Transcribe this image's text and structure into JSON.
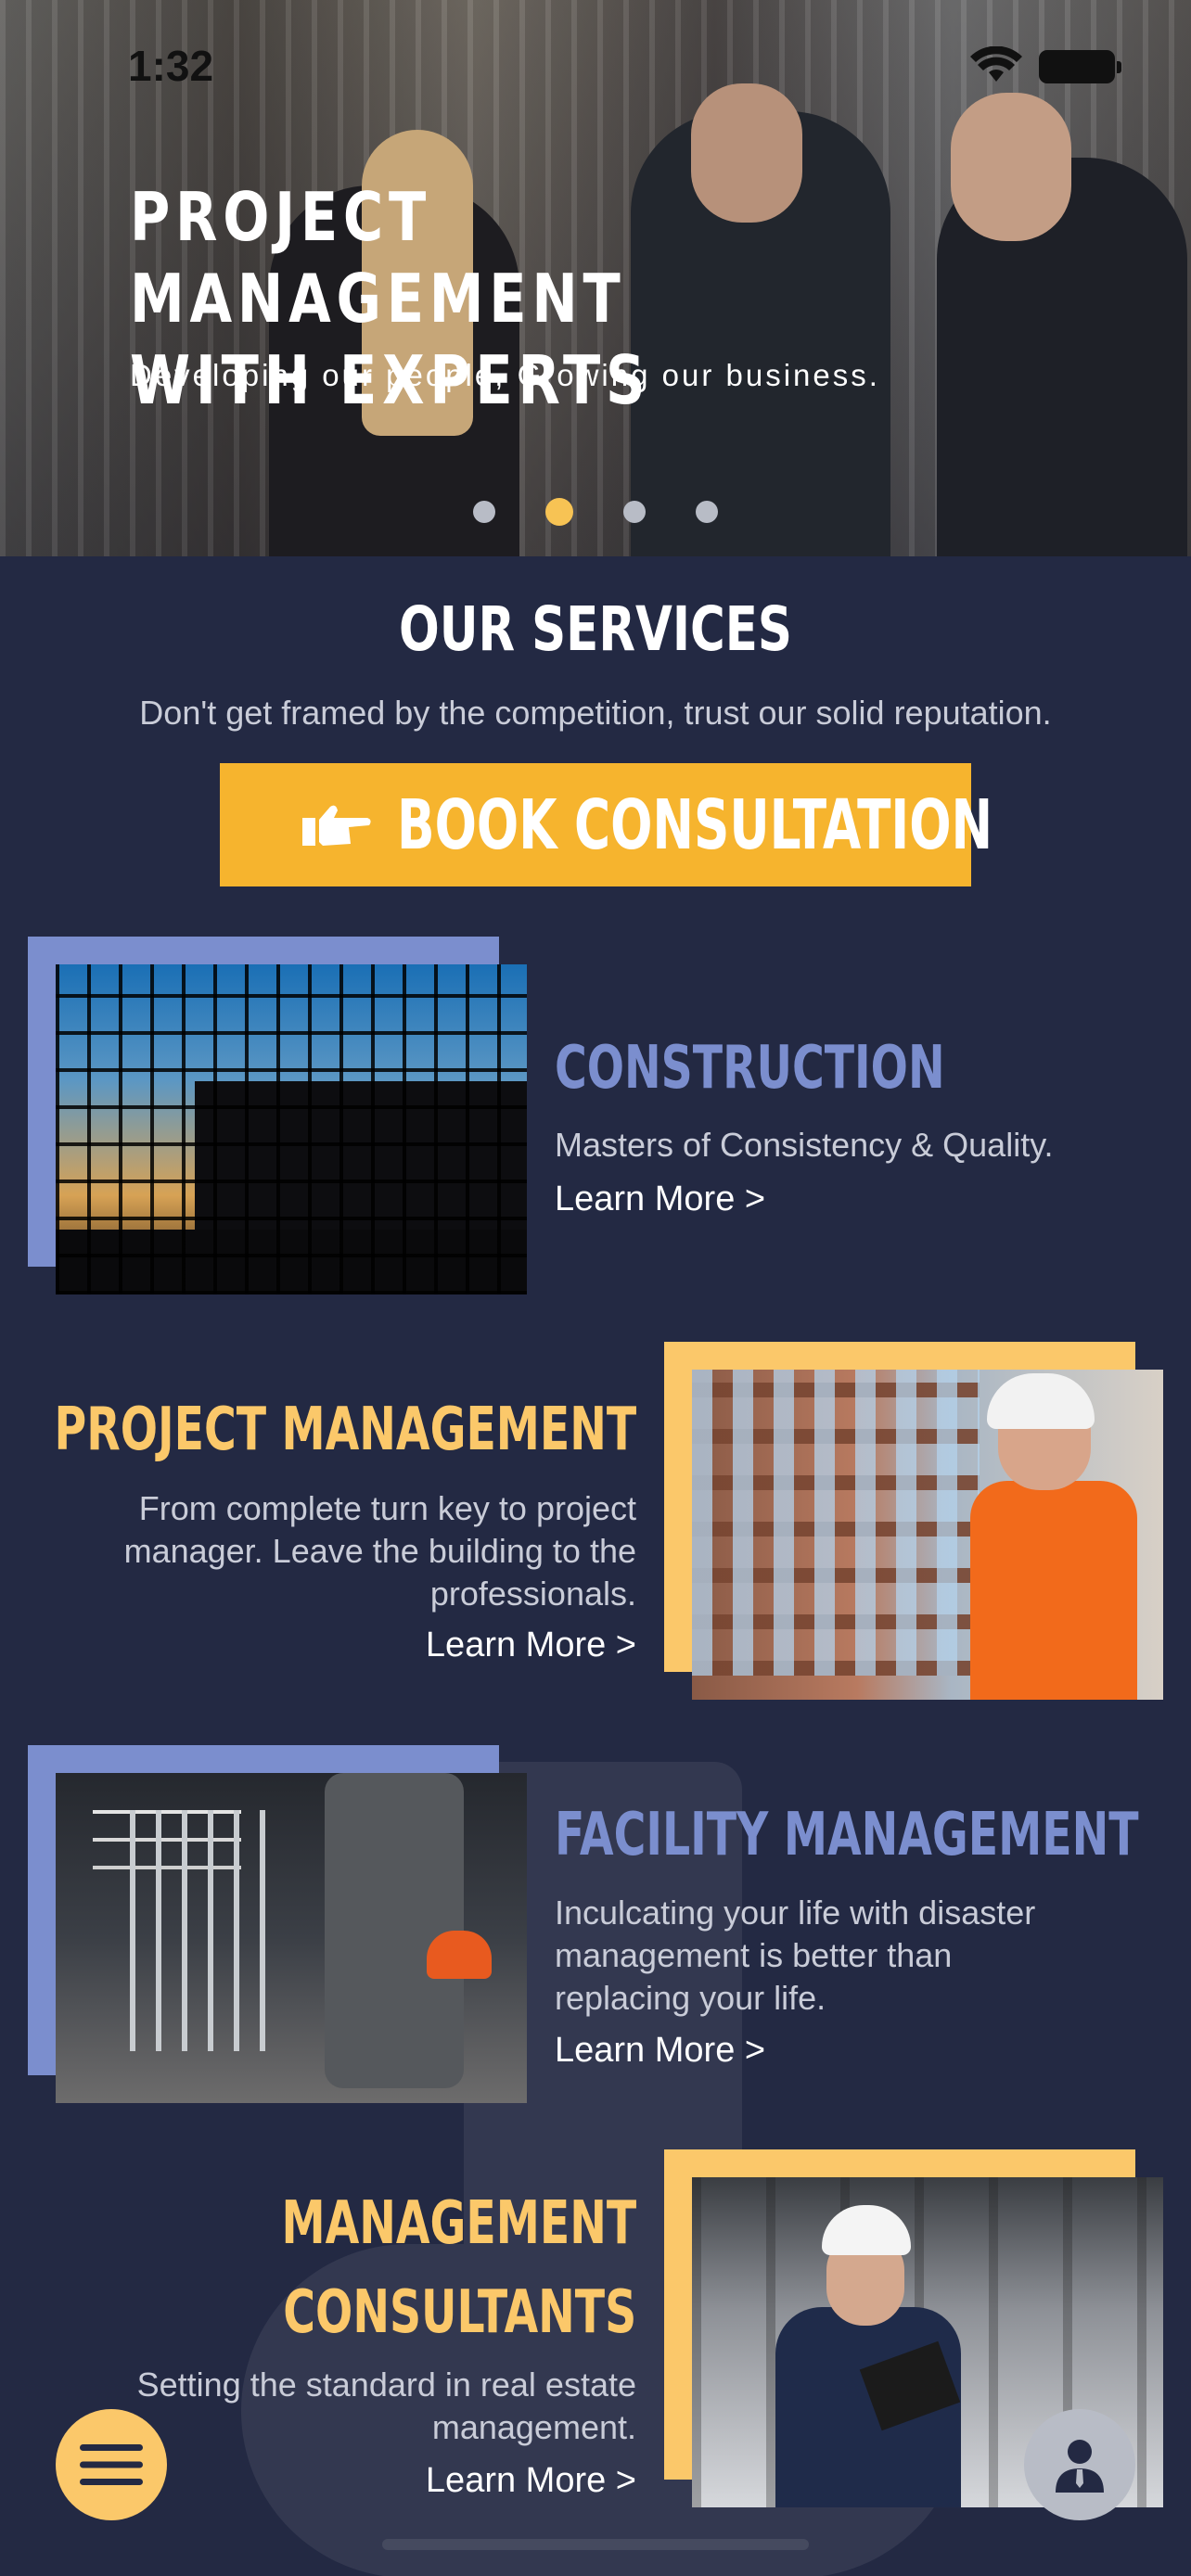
{
  "status_bar": {
    "time": "1:32"
  },
  "hero": {
    "title_line1": "PROJECT MANAGEMENT",
    "title_line2": "WITH EXPERTS",
    "subtitle": "Developing our people, Growing our business.",
    "carousel": {
      "total": 4,
      "active_index": 1
    }
  },
  "services": {
    "title": "OUR SERVICES",
    "subtitle": "Don't get framed by the competition, trust our solid reputation.",
    "book_button": {
      "label": "BOOK CONSULTATION",
      "icon": "pointing-hand-icon"
    },
    "items": [
      {
        "title": "CONSTRUCTION",
        "description": "Masters of Consistency & Quality.",
        "link": "Learn More >"
      },
      {
        "title": "PROJECT MANAGEMENT",
        "description_lines": [
          "From complete turn key to project",
          "manager. Leave the building to the",
          "professionals."
        ],
        "link": "Learn More >"
      },
      {
        "title": "FACILITY MANAGEMENT",
        "description_lines": [
          "Inculcating your life with disaster",
          "management is better than",
          "replacing your life."
        ],
        "link": "Learn More >"
      },
      {
        "title_lines": [
          "MANAGEMENT",
          "CONSULTANTS"
        ],
        "description_lines": [
          "Setting the standard in real estate",
          "management."
        ],
        "link": "Learn More >"
      }
    ]
  },
  "colors": {
    "background": "#232943",
    "accent_yellow": "#f6b42e",
    "accent_blue": "#7b8ece",
    "frame_yellow": "#fbc86a"
  },
  "fab": {
    "menu_icon": "hamburger-menu-icon",
    "profile_icon": "user-profile-icon"
  }
}
